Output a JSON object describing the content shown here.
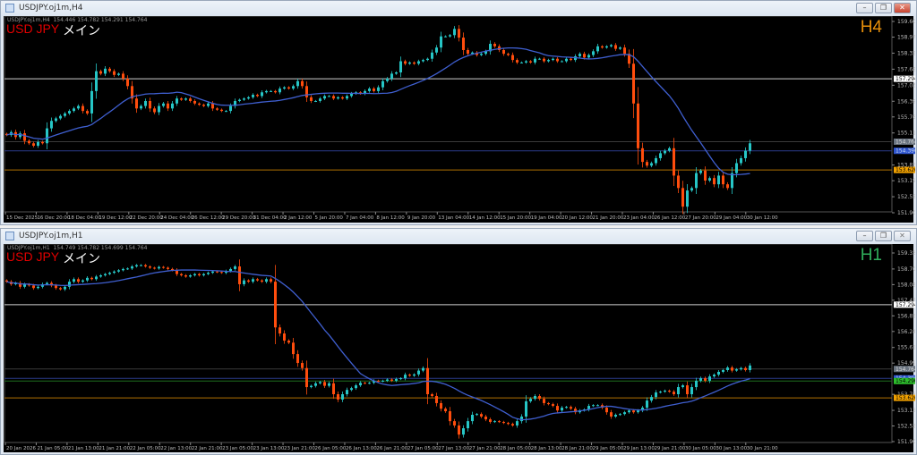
{
  "colors": {
    "bull": "#26c6c6",
    "bear": "#ff4d0d",
    "ma": "#3f5fd0",
    "bg": "#000000",
    "white_line": "#d0d0d0",
    "gray_line": "#3a3a3a",
    "blue_line": "#2a3a8a",
    "green_line": "#1e6e1e",
    "orange_line": "#b07000"
  },
  "windows": [
    {
      "title": "USDJPY.oj1m,H4",
      "legend": "USDJPY.oj1m,H4  154.446 154.782 154.291 154.764",
      "symbol": "USD JPY",
      "label": "メイン",
      "timeframe": "H4",
      "timeframe_color": "#e8900a",
      "buttons": {
        "minimize": "–",
        "restore": "❐",
        "close": "✕"
      },
      "chart_data": {
        "type": "candlestick",
        "price_ticks": [
          "159.600",
          "158.970",
          "158.325",
          "157.680",
          "157.035",
          "156.390",
          "155.760",
          "155.115",
          "153.825",
          "153.195",
          "152.550",
          "151.905"
        ],
        "price_range": [
          151.905,
          159.6
        ],
        "time_ticks": [
          "15 Dec 2025",
          "16 Dec 20:00",
          "18 Dec 04:00",
          "19 Dec 12:00",
          "22 Dec 20:00",
          "24 Dec 04:00",
          "26 Dec 12:00",
          "29 Dec 20:00",
          "31 Dec 04:00",
          "2 Jan 12:00",
          "5 Jan 20:00",
          "7 Jan 04:00",
          "8 Jan 12:00",
          "9 Jan 20:00",
          "13 Jan 04:00",
          "14 Jan 12:00",
          "15 Jan 20:00",
          "19 Jan 04:00",
          "20 Jan 12:00",
          "21 Jan 20:00",
          "23 Jan 04:00",
          "26 Jan 12:00",
          "27 Jan 20:00",
          "29 Jan 04:00",
          "30 Jan 12:00"
        ],
        "levels": [
          {
            "price": 157.294,
            "label": "157.294",
            "kind": "white"
          },
          {
            "price": 154.764,
            "label": "154.764",
            "kind": "gray"
          },
          {
            "price": 154.396,
            "label": "154.396",
            "kind": "blue"
          },
          {
            "price": 153.626,
            "label": "153.626",
            "kind": "orange"
          }
        ],
        "closes": [
          155.03,
          155.15,
          154.95,
          155.1,
          154.8,
          154.7,
          154.6,
          154.75,
          154.7,
          155.3,
          155.6,
          155.7,
          155.8,
          155.9,
          156.0,
          156.1,
          156.2,
          156.0,
          155.9,
          156.8,
          157.6,
          157.5,
          157.7,
          157.6,
          157.45,
          157.5,
          157.3,
          157.0,
          156.5,
          156.1,
          156.2,
          156.4,
          156.1,
          155.95,
          156.2,
          156.3,
          156.1,
          156.3,
          156.5,
          156.45,
          156.5,
          156.4,
          156.3,
          156.25,
          156.2,
          156.3,
          156.1,
          156.05,
          156.0,
          156.0,
          156.2,
          156.4,
          156.45,
          156.5,
          156.55,
          156.65,
          156.6,
          156.75,
          156.8,
          156.8,
          156.75,
          156.9,
          156.95,
          156.9,
          157.0,
          157.2,
          157.0,
          156.55,
          156.4,
          156.4,
          156.5,
          156.6,
          156.6,
          156.5,
          156.55,
          156.5,
          156.6,
          156.7,
          156.75,
          156.7,
          156.8,
          156.9,
          156.8,
          156.95,
          157.2,
          157.3,
          157.5,
          157.55,
          158.0,
          157.9,
          157.95,
          157.9,
          158.0,
          158.05,
          158.1,
          158.35,
          158.55,
          159.0,
          159.0,
          159.05,
          159.3,
          158.95,
          158.45,
          158.3,
          158.35,
          158.25,
          158.3,
          158.4,
          158.7,
          158.6,
          158.45,
          158.3,
          158.25,
          158.05,
          157.95,
          157.95,
          158.0,
          157.95,
          158.1,
          158.1,
          158.0,
          158.05,
          158.1,
          158.0,
          158.0,
          158.1,
          158.05,
          158.2,
          158.3,
          158.15,
          158.25,
          158.4,
          158.6,
          158.55,
          158.6,
          158.65,
          158.5,
          158.55,
          158.3,
          157.9,
          156.3,
          154.5,
          153.95,
          153.8,
          153.9,
          154.1,
          154.3,
          154.4,
          154.5,
          153.4,
          152.9,
          152.15,
          152.8,
          152.9,
          153.5,
          153.6,
          153.2,
          153.3,
          153.05,
          153.4,
          153.05,
          152.9,
          153.5,
          153.9,
          154.1,
          154.4,
          154.7
        ]
      }
    },
    {
      "title": "USDJPY.oj1m,H1",
      "legend": "USDJPY.oj1m,H1  154.749 154.782 154.699 154.764",
      "symbol": "USD JPY",
      "label": "メイン",
      "timeframe": "H1",
      "timeframe_color": "#2fae5a",
      "buttons": {
        "minimize": "–",
        "restore": "❐",
        "close": "✕"
      },
      "chart_data": {
        "type": "candlestick",
        "price_ticks": [
          "159.330",
          "158.700",
          "158.085",
          "157.470",
          "156.855",
          "156.240",
          "155.610",
          "154.995",
          "153.765",
          "153.135",
          "152.520",
          "151.905"
        ],
        "price_range": [
          151.905,
          159.33
        ],
        "time_ticks": [
          "20 Jan 2026",
          "21 Jan 05:00",
          "21 Jan 13:00",
          "21 Jan 21:00",
          "22 Jan 05:00",
          "22 Jan 13:00",
          "22 Jan 21:00",
          "23 Jan 05:00",
          "23 Jan 13:00",
          "23 Jan 21:00",
          "26 Jan 05:00",
          "26 Jan 13:00",
          "26 Jan 21:00",
          "27 Jan 05:00",
          "27 Jan 13:00",
          "27 Jan 21:00",
          "28 Jan 05:00",
          "28 Jan 13:00",
          "28 Jan 21:00",
          "29 Jan 05:00",
          "29 Jan 13:00",
          "29 Jan 21:00",
          "30 Jan 05:00",
          "30 Jan 13:00",
          "30 Jan 21:00"
        ],
        "levels": [
          {
            "price": 157.294,
            "label": "157.294",
            "kind": "white"
          },
          {
            "price": 154.764,
            "label": "154.764",
            "kind": "gray"
          },
          {
            "price": 154.396,
            "label": "154.396",
            "kind": "blue"
          },
          {
            "price": 154.29,
            "label": "154.290",
            "kind": "green"
          },
          {
            "price": 153.626,
            "label": "153.626",
            "kind": "orange"
          }
        ],
        "closes": [
          158.2,
          158.1,
          158.15,
          158.0,
          158.1,
          158.05,
          157.95,
          158.0,
          158.1,
          158.15,
          158.05,
          157.95,
          157.9,
          158.0,
          158.2,
          158.3,
          158.2,
          158.25,
          158.35,
          158.3,
          158.4,
          158.45,
          158.5,
          158.55,
          158.6,
          158.65,
          158.7,
          158.72,
          158.8,
          158.85,
          158.85,
          158.8,
          158.75,
          158.72,
          158.78,
          158.75,
          158.7,
          158.65,
          158.5,
          158.45,
          158.4,
          158.45,
          158.5,
          158.45,
          158.5,
          158.55,
          158.6,
          158.58,
          158.55,
          158.62,
          158.7,
          158.8,
          158.1,
          158.25,
          158.2,
          158.3,
          158.25,
          158.2,
          158.3,
          158.2,
          156.4,
          156.16,
          155.88,
          155.8,
          155.35,
          155.0,
          154.8,
          154.05,
          154.1,
          154.2,
          154.25,
          154.1,
          154.2,
          153.77,
          153.56,
          153.77,
          153.94,
          154.01,
          154.12,
          154.22,
          154.2,
          154.22,
          154.3,
          154.28,
          154.3,
          154.35,
          154.3,
          154.37,
          154.4,
          154.54,
          154.5,
          154.55,
          154.7,
          154.8,
          153.77,
          153.7,
          153.42,
          153.2,
          153.1,
          152.71,
          152.54,
          152.18,
          152.43,
          152.71,
          152.96,
          152.99,
          152.89,
          152.78,
          152.68,
          152.71,
          152.68,
          152.64,
          152.6,
          152.54,
          152.71,
          152.89,
          153.49,
          153.59,
          153.7,
          153.59,
          153.42,
          153.38,
          153.31,
          153.13,
          153.24,
          153.27,
          153.2,
          153.06,
          153.13,
          153.17,
          153.31,
          153.34,
          153.34,
          153.24,
          153.06,
          152.89,
          152.96,
          152.99,
          153.06,
          153.13,
          153.06,
          153.13,
          153.24,
          153.52,
          153.66,
          153.84,
          153.87,
          153.91,
          153.87,
          153.77,
          154.05,
          154.12,
          153.77,
          154.05,
          154.3,
          154.4,
          154.3,
          154.47,
          154.54,
          154.65,
          154.72,
          154.82,
          154.7,
          154.75,
          154.8,
          154.72,
          154.9
        ]
      }
    }
  ]
}
